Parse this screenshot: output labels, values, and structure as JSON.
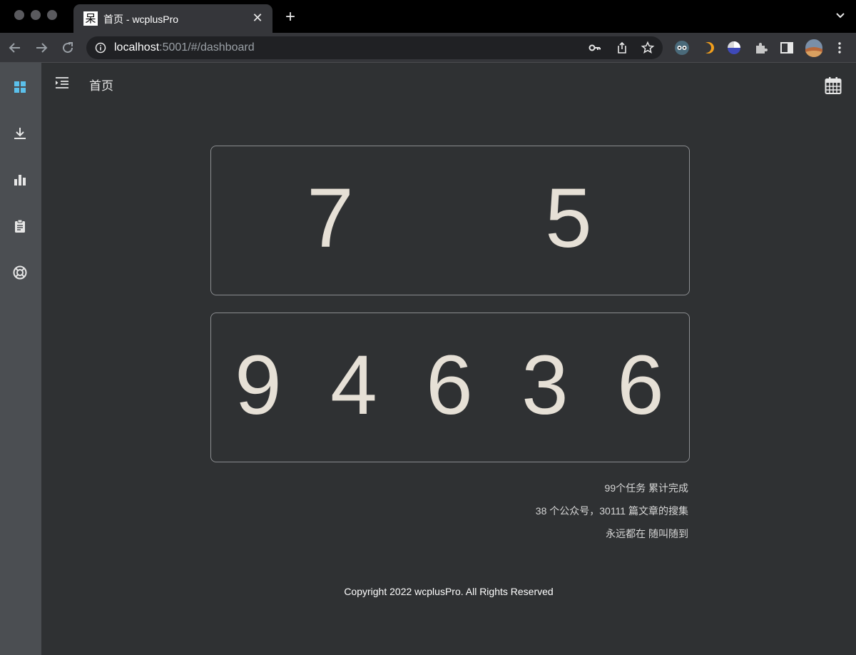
{
  "browser": {
    "tab_title": "首页 - wcplusPro",
    "tab_favicon_char": "呆",
    "url_host": "localhost",
    "url_path": ":5001/#/dashboard",
    "new_tab_label": "+",
    "close_label": "✕"
  },
  "header": {
    "title": "首页"
  },
  "sidebar": {
    "items": [
      {
        "icon": "dashboard-grid-icon",
        "active": true
      },
      {
        "icon": "download-icon",
        "active": false
      },
      {
        "icon": "bar-chart-icon",
        "active": false
      },
      {
        "icon": "clipboard-icon",
        "active": false
      },
      {
        "icon": "lifebuoy-icon",
        "active": false
      }
    ]
  },
  "counters": {
    "top_digits": [
      "7",
      "5"
    ],
    "bottom_digits": [
      "9",
      "4",
      "6",
      "3",
      "6"
    ]
  },
  "stats": {
    "line1": "99个任务 累计完成",
    "line2": "38 个公众号，30111 篇文章的搜集",
    "line3": "永远都在 随叫随到"
  },
  "footer": {
    "copyright": "Copyright 2022 wcplusPro. All Rights Reserved"
  },
  "colors": {
    "accent": "#5bc0eb",
    "background": "#2f3133",
    "sidebar": "#4b4e52",
    "digit": "#e6e0d6"
  }
}
